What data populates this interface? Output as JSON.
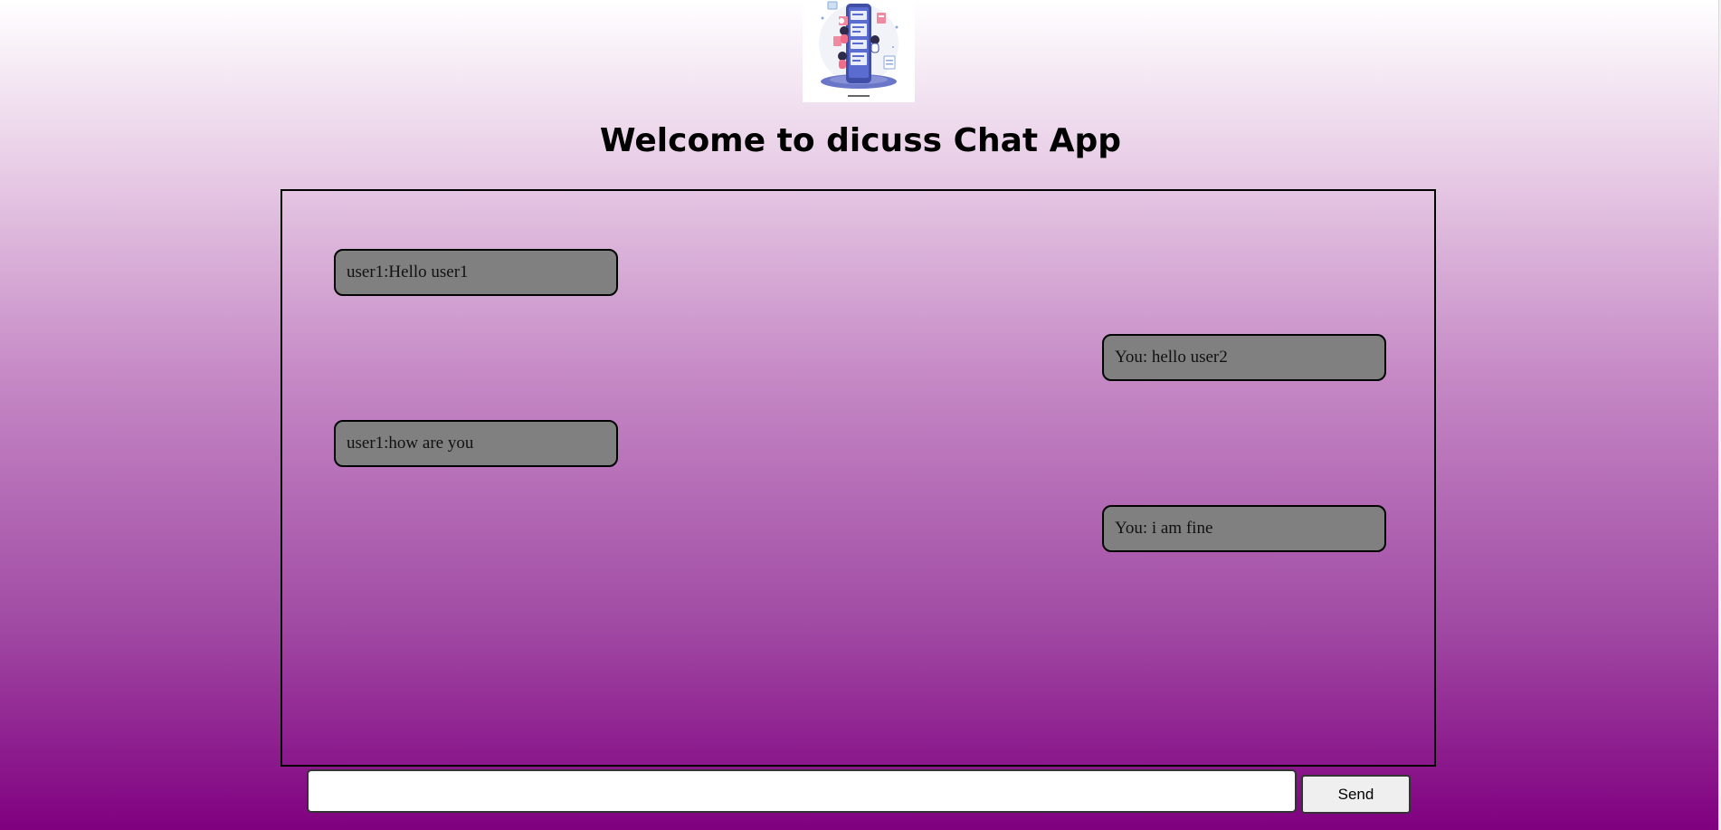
{
  "app": {
    "title": "Welcome to dicuss Chat App",
    "logo_icon": "chat-app-illustration-icon"
  },
  "messages": [
    {
      "sender": "other",
      "text": "user1:Hello user1"
    },
    {
      "sender": "me",
      "text": "You: hello user2"
    },
    {
      "sender": "other",
      "text": "user1:how are you"
    },
    {
      "sender": "me",
      "text": "You: i am fine"
    }
  ],
  "composer": {
    "input_value": "",
    "send_label": "Send"
  },
  "colors": {
    "background_top": "#ffffff",
    "background_bottom": "#800080",
    "bubble": "#808080",
    "border": "#000000"
  }
}
